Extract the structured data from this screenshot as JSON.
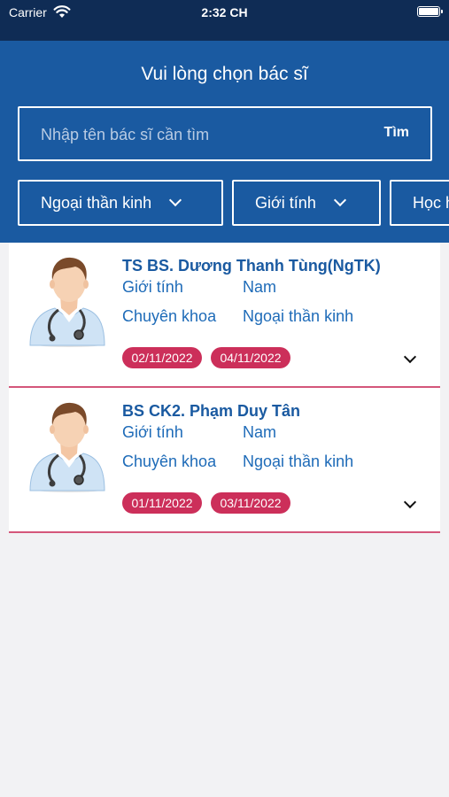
{
  "status_bar": {
    "carrier": "Carrier",
    "time": "2:32 CH"
  },
  "header": {
    "title": "Vui lòng chọn bác sĩ",
    "search": {
      "placeholder": "Nhập tên bác sĩ cần tìm",
      "value": "",
      "button_label": "Tìm"
    },
    "filters": [
      {
        "label": "Ngoại thần kinh",
        "icon": "chevron-down-icon"
      },
      {
        "label": "Giới tính",
        "icon": "chevron-down-icon"
      },
      {
        "label": "Học hàm"
      }
    ]
  },
  "doctors": [
    {
      "name": "TS BS. Dương Thanh Tùng(NgTK)",
      "gender_label": "Giới tính",
      "gender": "Nam",
      "specialty_label": "Chuyên khoa",
      "specialty": "Ngoại thần kinh",
      "dates": [
        "02/11/2022",
        "04/11/2022"
      ]
    },
    {
      "name": "BS CK2. Phạm Duy Tân",
      "gender_label": "Giới tính",
      "gender": "Nam",
      "specialty_label": "Chuyên khoa",
      "specialty": "Ngoại thần kinh",
      "dates": [
        "01/11/2022",
        "03/11/2022"
      ]
    }
  ],
  "colors": {
    "status_bar_bg": "#0f2c55",
    "header_bg": "#1a5aa1",
    "text_blue": "#1e6bb8",
    "date_tag": "#cc2f5a",
    "divider": "#d4567a"
  }
}
